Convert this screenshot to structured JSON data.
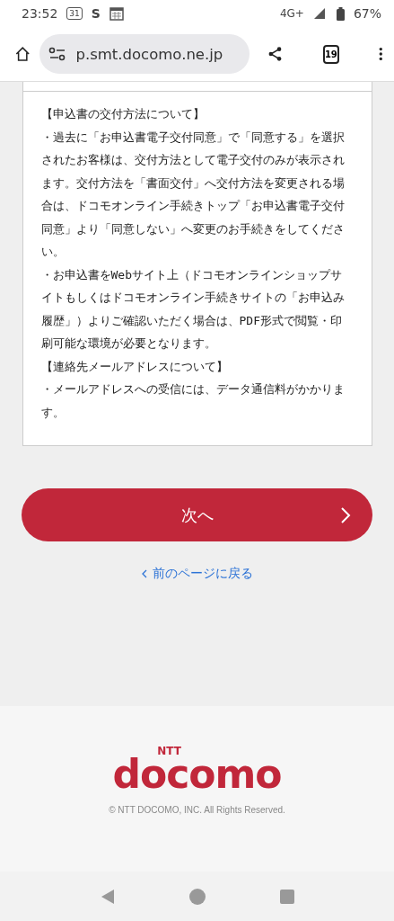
{
  "status_bar": {
    "time": "23:52",
    "calendar_badge": "31",
    "s_badge": "S",
    "network": "4G+",
    "battery": "67%"
  },
  "browser": {
    "url": "p.smt.docomo.ne.jp",
    "tab_count": "19"
  },
  "notice": {
    "paragraphs": [
      "【申込書の交付方法について】",
      "・過去に「お申込書電子交付同意」で「同意する」を選択されたお客様は、交付方法として電子交付のみが表示されます。交付方法を「書面交付」へ交付方法を変更される場合は、ドコモオンライン手続きトップ「お申込書電子交付同意」より「同意しない」へ変更のお手続きをしてください。",
      "・お申込書をWebサイト上（ドコモオンラインショップサイトもしくはドコモオンライン手続きサイトの「お申込み履歴」）よりご確認いただく場合は、PDF形式で閲覧・印刷可能な環境が必要となります。",
      "【連絡先メールアドレスについて】",
      "・メールアドレスへの受信には、データ通信料がかかります。"
    ]
  },
  "next_button": {
    "label": "次へ"
  },
  "back_link": {
    "label": "前のページに戻る"
  },
  "footer": {
    "logo_top": "NTT",
    "logo": "docomo",
    "copyright": "© NTT DOCOMO, INC. All Rights Reserved."
  }
}
